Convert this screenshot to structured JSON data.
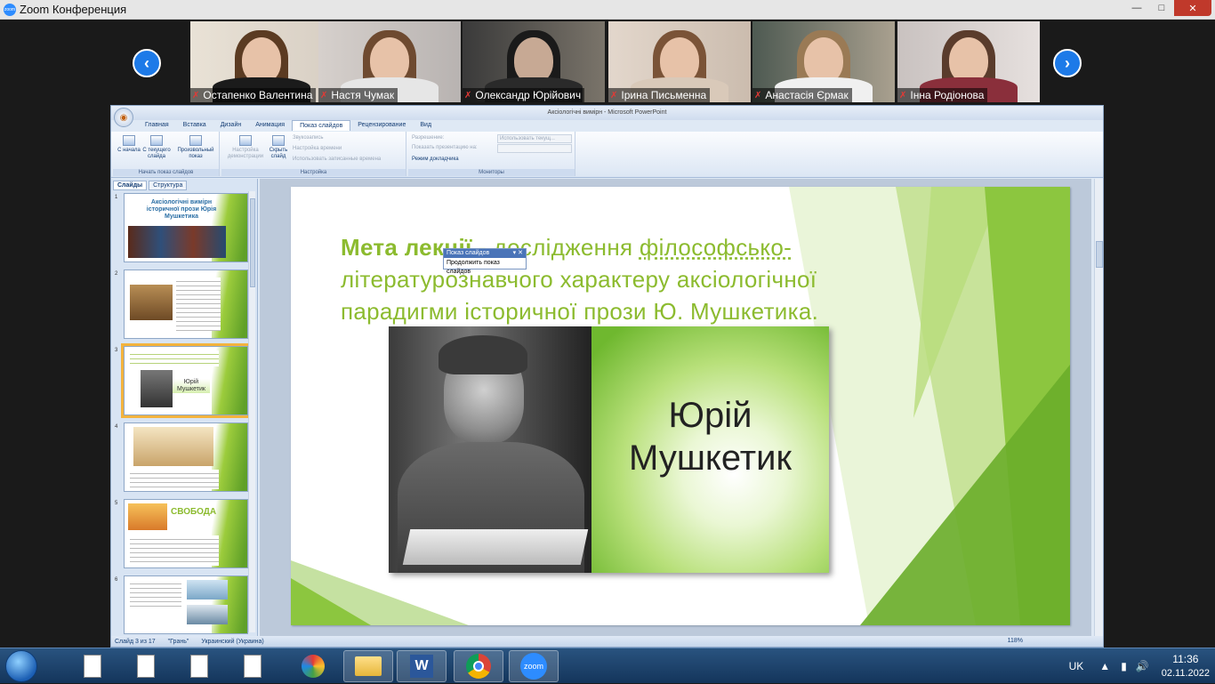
{
  "zoom": {
    "title": "Zoom Конференция",
    "participants": [
      {
        "name": "Остапенко Валентина"
      },
      {
        "name": "Настя Чумак"
      },
      {
        "name": "Олександр Юрійович"
      },
      {
        "name": "Ірина Письменна"
      },
      {
        "name": "Анастасія Єрмак"
      },
      {
        "name": "Інна Родіонова"
      }
    ]
  },
  "ppt": {
    "window_title": "Аксіологічні вимірн - Microsoft PowerPoint",
    "tabs": [
      "Главная",
      "Вставка",
      "Дизайн",
      "Анимация",
      "Показ слайдов",
      "Рецензирование",
      "Вид"
    ],
    "active_tab": "Показ слайдов",
    "ribbon": {
      "from_start": "С начала",
      "from_current": "С текущего слайда",
      "custom_show": "Произвольный показ",
      "group_start": "Начать показ слайдов",
      "setup": "Настройка демонстрации",
      "hide_slide": "Скрыть слайд",
      "record": "Звукозапись",
      "rehearse": "Настройка времени",
      "use_timings": "Использовать записанные времена",
      "group_setup": "Настройка",
      "resolution_label": "Разрешение:",
      "resolution_value": "Использовать текущ...",
      "show_on_label": "Показать презентацию на:",
      "presenter_view": "Режим докладчика",
      "group_monitors": "Мониторы"
    },
    "slideshow_toolbar": {
      "title": "Показ слайдов",
      "button": "Продолжить показ слайдов"
    },
    "panel_tabs": [
      "Слайды",
      "Структура"
    ],
    "thumbnails": [
      {
        "num": "1",
        "text": "Аксіологічні вимірн історичної прози Юрія Мушкетика"
      },
      {
        "num": "2",
        "text": ""
      },
      {
        "num": "3",
        "text": "Юрій Мушкетик"
      },
      {
        "num": "4",
        "text": ""
      },
      {
        "num": "5",
        "text": "СВОБОДА"
      },
      {
        "num": "6",
        "text": ""
      }
    ],
    "slide": {
      "heading_lead": "Мета лекції - ",
      "heading_rest": "дослідження ",
      "heading_link": "філософсько-",
      "heading_tail": "літературознавчого характеру аксіологічної парадигми історичної прози Ю. Мушкетика.",
      "photo_caption": "Юрій Мушкетик"
    },
    "status": {
      "slide_of": "Слайд 3 из 17",
      "theme": "\"Грань\"",
      "language": "Украинский (Украина)",
      "zoom": "118%"
    }
  },
  "taskbar": {
    "lang": "UK",
    "time": "11:36",
    "date": "02.11.2022",
    "zoom_label": "zoom"
  }
}
